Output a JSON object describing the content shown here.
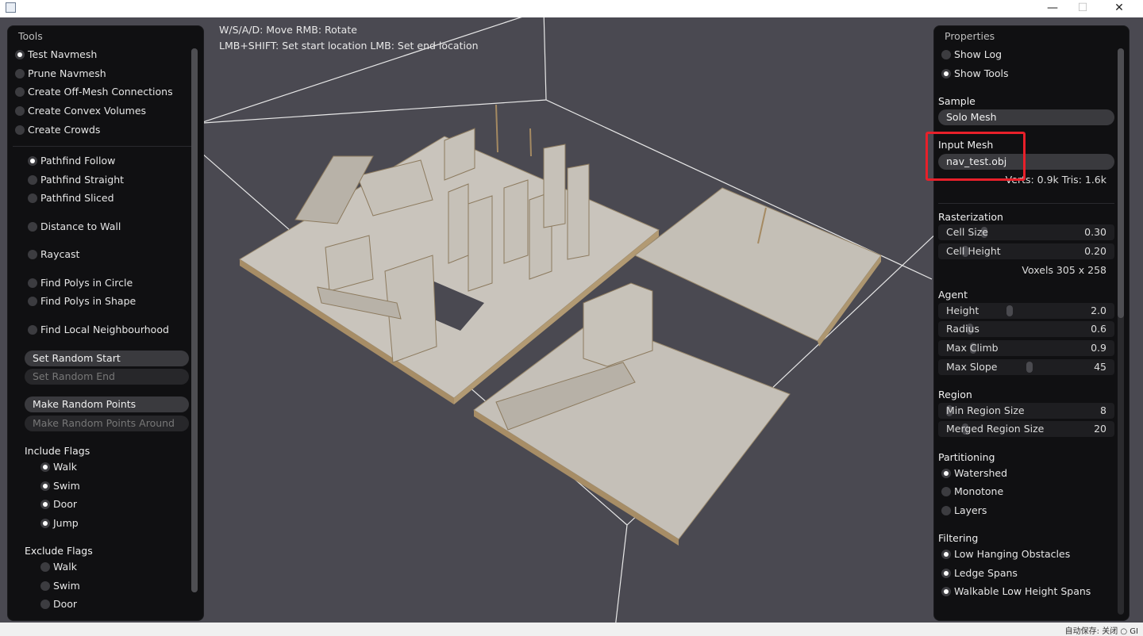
{
  "window": {
    "controls": {
      "minimize": "—",
      "maximize": "☐",
      "close": "✕"
    }
  },
  "viewport": {
    "help_line1": "W/S/A/D: Move  RMB: Rotate",
    "help_line2": "LMB+SHIFT: Set start location  LMB: Set end location"
  },
  "tools": {
    "title": "Tools",
    "modes": [
      {
        "label": "Test Navmesh",
        "checked": true
      },
      {
        "label": "Prune Navmesh",
        "checked": false
      },
      {
        "label": "Create Off-Mesh Connections",
        "checked": false
      },
      {
        "label": "Create Convex Volumes",
        "checked": false
      },
      {
        "label": "Create Crowds",
        "checked": false
      }
    ],
    "tests": [
      {
        "label": "Pathfind Follow",
        "checked": true
      },
      {
        "label": "Pathfind Straight",
        "checked": false
      },
      {
        "label": "Pathfind Sliced",
        "checked": false
      },
      {
        "label": "Distance to Wall",
        "checked": false
      },
      {
        "label": "Raycast",
        "checked": false
      },
      {
        "label": "Find Polys in Circle",
        "checked": false
      },
      {
        "label": "Find Polys in Shape",
        "checked": false
      },
      {
        "label": "Find Local Neighbourhood",
        "checked": false
      }
    ],
    "buttons": {
      "set_random_start": "Set Random Start",
      "set_random_end": "Set Random End",
      "make_random_points": "Make Random Points",
      "make_random_points_around": "Make Random Points Around"
    },
    "include_flags": {
      "title": "Include Flags",
      "items": [
        {
          "label": "Walk",
          "checked": true
        },
        {
          "label": "Swim",
          "checked": true
        },
        {
          "label": "Door",
          "checked": true
        },
        {
          "label": "Jump",
          "checked": true
        }
      ]
    },
    "exclude_flags": {
      "title": "Exclude Flags",
      "items": [
        {
          "label": "Walk",
          "checked": false
        },
        {
          "label": "Swim",
          "checked": false
        },
        {
          "label": "Door",
          "checked": false
        }
      ]
    }
  },
  "properties": {
    "title": "Properties",
    "show_log": {
      "label": "Show Log",
      "checked": false
    },
    "show_tools": {
      "label": "Show Tools",
      "checked": true
    },
    "sample": {
      "title": "Sample",
      "value": "Solo Mesh"
    },
    "input_mesh": {
      "title": "Input Mesh",
      "value": "nav_test.obj",
      "stats": "Verts: 0.9k  Tris: 1.6k"
    },
    "rasterization": {
      "title": "Rasterization",
      "cell_size": {
        "label": "Cell Size",
        "value": "0.30"
      },
      "cell_height": {
        "label": "Cell Height",
        "value": "0.20"
      },
      "voxels": "Voxels  305 x 258"
    },
    "agent": {
      "title": "Agent",
      "height": {
        "label": "Height",
        "value": "2.0"
      },
      "radius": {
        "label": "Radius",
        "value": "0.6"
      },
      "max_climb": {
        "label": "Max Climb",
        "value": "0.9"
      },
      "max_slope": {
        "label": "Max Slope",
        "value": "45"
      }
    },
    "region": {
      "title": "Region",
      "min_region_size": {
        "label": "Min Region Size",
        "value": "8"
      },
      "merged_region_size": {
        "label": "Merged Region Size",
        "value": "20"
      }
    },
    "partitioning": {
      "title": "Partitioning",
      "options": [
        {
          "label": "Watershed",
          "checked": true
        },
        {
          "label": "Monotone",
          "checked": false
        },
        {
          "label": "Layers",
          "checked": false
        }
      ]
    },
    "filtering": {
      "title": "Filtering",
      "options": [
        {
          "label": "Low Hanging Obstacles",
          "checked": true
        },
        {
          "label": "Ledge Spans",
          "checked": true
        },
        {
          "label": "Walkable Low Height Spans",
          "checked": true
        }
      ]
    }
  },
  "statusbar": {
    "text": "自动保存: 关闭  ○ GI"
  },
  "colors": {
    "highlight": "#e8202a",
    "mesh": "#c9c4bc",
    "viewport": "#4a4951"
  }
}
